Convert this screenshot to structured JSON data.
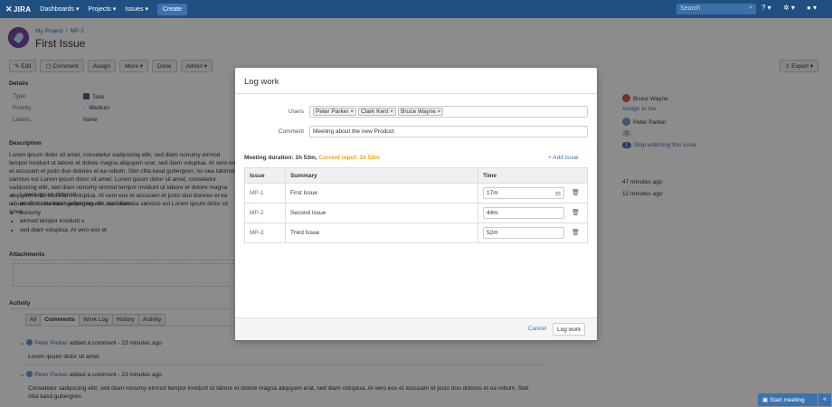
{
  "nav": {
    "logo": "JIRA",
    "items": [
      "Dashboards",
      "Projects",
      "Issues"
    ],
    "create": "Create",
    "search_placeholder": "Search"
  },
  "issue": {
    "project": "My Project",
    "key": "MP-1",
    "title": "First Issue"
  },
  "toolbar": {
    "edit": "Edit",
    "comment": "Comment",
    "assign": "Assign",
    "more": "More",
    "done": "Done",
    "admin": "Admin",
    "export": "Export"
  },
  "details": {
    "heading": "Details",
    "type_label": "Type:",
    "type_value": "Task",
    "priority_label": "Priority:",
    "priority_value": "Medium",
    "labels_label": "Labels:",
    "labels_value": "None"
  },
  "description": {
    "heading": "Description",
    "text": "Lorem ipsum dolor sit amet, consetetur sadipscing elitr, sed diam nonumy eirmod tempor invidunt ut labore et dolore magna aliquyam erat, sed diam voluptua. At vero eos et accusam et justo duo dolores et ea rebum. Stet clita kasd gubergren, no sea takimata sanctus est Lorem ipsum dolor sit amet. Lorem ipsum dolor sit amet, consetetur sadipscing elitr, sed diam nonumy eirmod tempor invidunt ut labore et dolore magna aliquyam erat, sed diam voluptua. At vero eos et accusam et justo duo dolores et ea rebum. Stet clita kasd gubergren, no sea takimata sanctus est Lorem ipsum dolor sit amet.",
    "bullets": [
      "Lorem ipsum dolor sit",
      "amet, consetetur sadipscing elitr, sed diam",
      "nonumy",
      "eirmod tempor invidunt u",
      "sed diam voluptua. At vero eos et"
    ]
  },
  "attachments": {
    "heading": "Attachments"
  },
  "activity": {
    "heading": "Activity",
    "tabs": [
      "All",
      "Comments",
      "Work Log",
      "History",
      "Activity"
    ],
    "comments": [
      {
        "author": "Peter Parker",
        "meta": "added a comment - 23 minutes ago",
        "body": "Lorem ipsum dolor sit amet"
      },
      {
        "author": "Peter Parker",
        "meta": "added a comment - 23 minutes ago",
        "body": "Consetetur sadipscing elitr, sed diam nonumy eirmod tempor invidunt ut labore et dolore magna aliquyam erat, sed diam voluptua. At vero eos et accusam et justo duo dolores et ea rebum. Stet clita kasd gubergren."
      }
    ]
  },
  "people": {
    "assignee": "Bruce Wayne",
    "assign_to_me": "Assign to me",
    "reporter": "Peter Parker",
    "watchers_count": "0",
    "watchers_badge": "1",
    "stop_watching": "Stop watching this issue"
  },
  "dates": {
    "created": "47 minutes ago",
    "updated": "12 minutes ago"
  },
  "modal": {
    "title": "Log work",
    "users_label": "Users",
    "users": [
      "Peter Parker",
      "Clark Kent",
      "Bruce Wayne"
    ],
    "comment_label": "Comment",
    "comment_value": "Meeting about the new Product",
    "meeting_duration": "Meeting duration: 1h 53m,",
    "current_input": "Current input: 1h 53m",
    "add_issue": "Add issue",
    "columns": [
      "Issue",
      "Summary",
      "Time"
    ],
    "rows": [
      {
        "key": "MP-1",
        "summary": "First Issue",
        "time": "17m"
      },
      {
        "key": "MP-2",
        "summary": "Second Issue",
        "time": "44m"
      },
      {
        "key": "MP-3",
        "summary": "Third Issue",
        "time": "52m"
      }
    ],
    "cancel": "Cancel",
    "submit": "Log work"
  },
  "footer": {
    "start_meeting": "Start meeting",
    "close": "«"
  },
  "colors": {
    "nav_bg": "#205081",
    "link": "#3b73af",
    "accent": "#f0a30a"
  }
}
